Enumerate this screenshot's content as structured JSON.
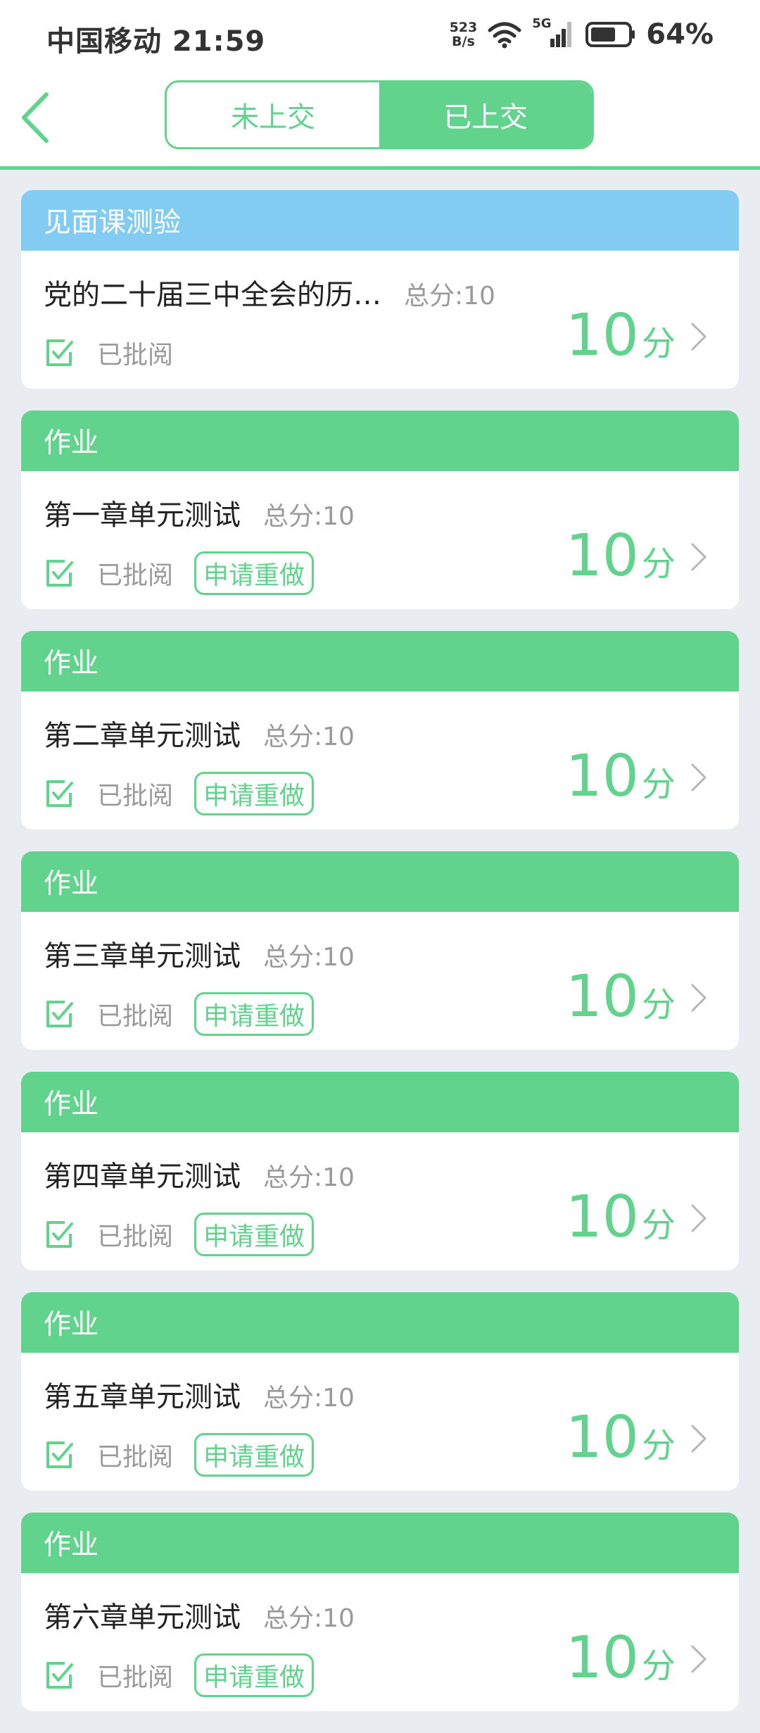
{
  "status_bar": {
    "carrier_time": "中国移动 21:59",
    "net_speed_value": "523",
    "net_speed_unit": "B/s",
    "network_type": "5G",
    "battery_percent": "64%"
  },
  "header": {
    "tabs": [
      {
        "label": "未上交",
        "active": false
      },
      {
        "label": "已上交",
        "active": true
      }
    ]
  },
  "colors": {
    "accent_green": "#61d38d",
    "header_blue": "#82cbf2"
  },
  "cards": [
    {
      "category": "见面课测验",
      "title": "党的二十届三中全会的历…",
      "total": "总分:10",
      "status": "已批阅",
      "redo": "",
      "score": "10",
      "unit": "分"
    },
    {
      "category": "作业",
      "title": "第一章单元测试",
      "total": "总分:10",
      "status": "已批阅",
      "redo": "申请重做",
      "score": "10",
      "unit": "分"
    },
    {
      "category": "作业",
      "title": "第二章单元测试",
      "total": "总分:10",
      "status": "已批阅",
      "redo": "申请重做",
      "score": "10",
      "unit": "分"
    },
    {
      "category": "作业",
      "title": "第三章单元测试",
      "total": "总分:10",
      "status": "已批阅",
      "redo": "申请重做",
      "score": "10",
      "unit": "分"
    },
    {
      "category": "作业",
      "title": "第四章单元测试",
      "total": "总分:10",
      "status": "已批阅",
      "redo": "申请重做",
      "score": "10",
      "unit": "分"
    },
    {
      "category": "作业",
      "title": "第五章单元测试",
      "total": "总分:10",
      "status": "已批阅",
      "redo": "申请重做",
      "score": "10",
      "unit": "分"
    },
    {
      "category": "作业",
      "title": "第六章单元测试",
      "total": "总分:10",
      "status": "已批阅",
      "redo": "申请重做",
      "score": "10",
      "unit": "分"
    }
  ]
}
